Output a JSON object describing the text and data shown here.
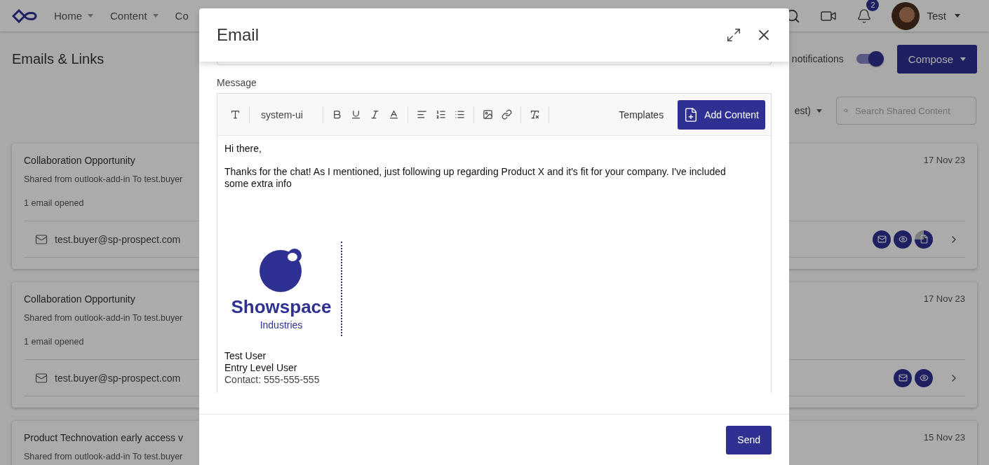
{
  "nav": {
    "items": [
      {
        "label": "Home",
        "caret": true
      },
      {
        "label": "Content",
        "caret": true
      },
      {
        "label": "Co",
        "caret": false
      }
    ],
    "notification_count": "2",
    "user": "Test"
  },
  "page": {
    "title": "Emails & Links",
    "notifications_label": "notifications",
    "notifications_on": true,
    "compose": "Compose",
    "sort_label": "est)",
    "search_placeholder": "Search Shared Content"
  },
  "cards": [
    {
      "title": "Collaboration Opportunity",
      "subtitle": "Shared from outlook-add-in To test.buyer",
      "stat": "1 email opened",
      "date": "17 Nov 23",
      "recipient": "test.buyer@sp-prospect.com",
      "badges": [
        {
          "kind": "mail"
        },
        {
          "kind": "eye"
        },
        {
          "kind": "file"
        }
      ]
    },
    {
      "title": "Collaboration Opportunity",
      "subtitle": "Shared from outlook-add-in To test.buyer",
      "stat": "1 email opened",
      "date": "17 Nov 23",
      "recipient": "test.buyer@sp-prospect.com",
      "badges": [
        {
          "kind": "mail"
        },
        {
          "kind": "eye"
        }
      ]
    },
    {
      "title": "Product Technovation early access v",
      "subtitle": "Shared from outlook-add-in To test.buyer",
      "date": "15 Nov 23"
    }
  ],
  "modal": {
    "title": "Email",
    "message_label": "Message",
    "font": "system-ui",
    "templates": "Templates",
    "add_content": "Add Content",
    "body": [
      "Hi there,",
      "Thanks for the chat! As I mentioned, just following up regarding Product X and it's fit for your company. I've included some extra info"
    ],
    "signature": {
      "company": "Showspace",
      "division": "Industries",
      "lines": [
        "Test User",
        "Entry Level User",
        "Contact: 555-555-555"
      ]
    },
    "send": "Send"
  }
}
